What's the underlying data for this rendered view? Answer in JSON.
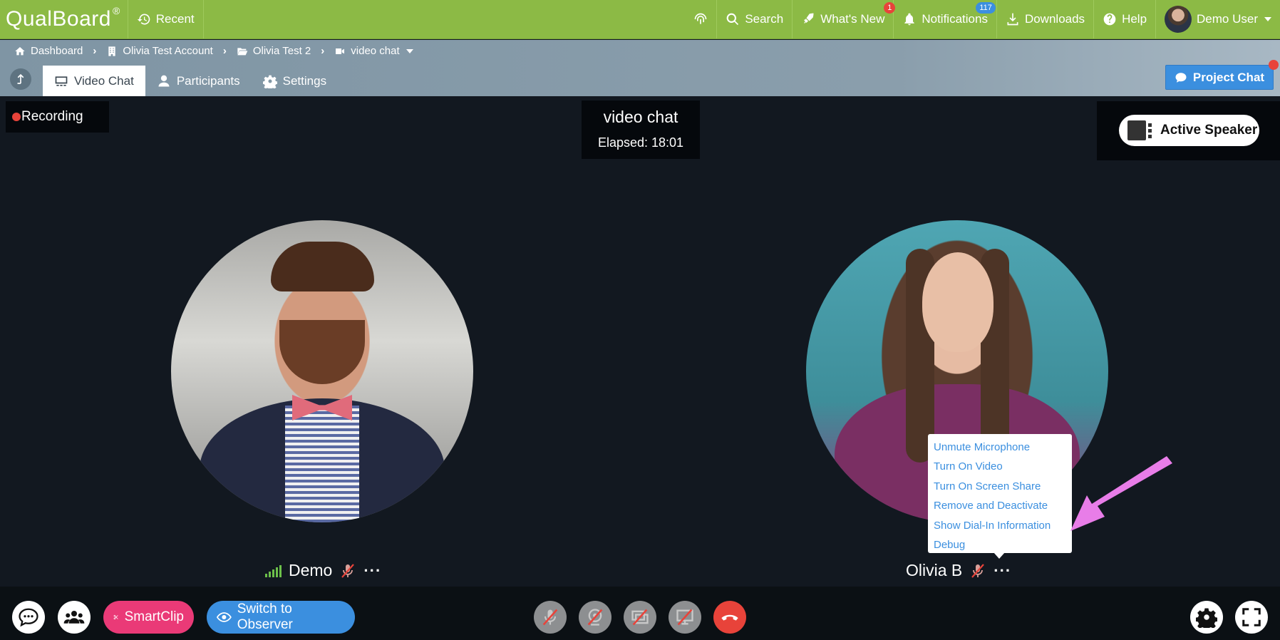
{
  "app": {
    "brand": "QualBoard",
    "brand_mark": "®"
  },
  "topbar": {
    "recent": "Recent",
    "search": "Search",
    "whats_new": "What's New",
    "whats_new_badge": "1",
    "notifications": "Notifications",
    "notifications_badge": "117",
    "downloads": "Downloads",
    "help": "Help",
    "user": "Demo User"
  },
  "breadcrumb": [
    {
      "label": "Dashboard",
      "icon": "home-icon"
    },
    {
      "label": "Olivia Test Account",
      "icon": "building-icon"
    },
    {
      "label": "Olivia Test 2",
      "icon": "folder-open-icon"
    },
    {
      "label": "video chat",
      "icon": "video-camera-icon"
    }
  ],
  "tabs": [
    {
      "label": "Video Chat",
      "icon": "video-chat-icon",
      "active": true
    },
    {
      "label": "Participants",
      "icon": "user-icon",
      "active": false
    },
    {
      "label": "Settings",
      "icon": "gear-icon",
      "active": false
    }
  ],
  "project_chat": {
    "label": "Project Chat"
  },
  "stage": {
    "recording_label": "Recording",
    "title": "video chat",
    "elapsed": "Elapsed: 18:01",
    "active_speaker_label": "Active Speaker"
  },
  "participants": [
    {
      "name": "Demo",
      "muted": true
    },
    {
      "name": "Olivia B",
      "muted": true
    }
  ],
  "context_menu": {
    "items": [
      "Unmute Microphone",
      "Turn On Video",
      "Turn On Screen Share",
      "Remove and Deactivate",
      "Show Dial-In Information",
      "Debug"
    ]
  },
  "bottombar": {
    "smartclip": "SmartClip",
    "observer": "Switch to Observer"
  },
  "colors": {
    "topbar": "#8cba45",
    "accent_blue": "#3b8fdf",
    "smartclip_pink": "#ea3a77",
    "hangup_red": "#e8433a",
    "annotation_arrow": "#e87de8"
  }
}
